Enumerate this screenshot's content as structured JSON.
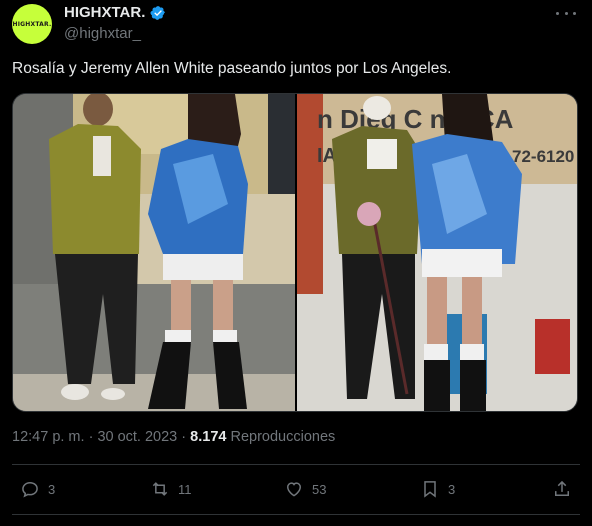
{
  "account": {
    "avatar_text": "HIGHXTAR.",
    "display_name": "HIGHXTAR.",
    "handle": "@highxtar_",
    "avatar_color": "#c6ff3a",
    "verified_color": "#1d9bf0"
  },
  "tweet": {
    "text": "Rosalía y Jeremy Allen White paseando juntos por Los Angeles.",
    "time": "12:47 p. m.",
    "sep1": " · ",
    "date": "30 oct. 2023",
    "sep2": " · ",
    "views": "8.174",
    "views_label": " Reproducciones"
  },
  "media": {
    "sign_text": "n Dieg  C  nty CA",
    "sign_text_2": "IA",
    "sign_phone": "72-6120"
  },
  "actions": {
    "reply_count": "3",
    "retweet_count": "11",
    "like_count": "53",
    "bookmark_count": "3"
  },
  "icons": [
    "verified-icon",
    "more-icon",
    "reply-icon",
    "retweet-icon",
    "like-icon",
    "bookmark-icon",
    "share-icon"
  ]
}
